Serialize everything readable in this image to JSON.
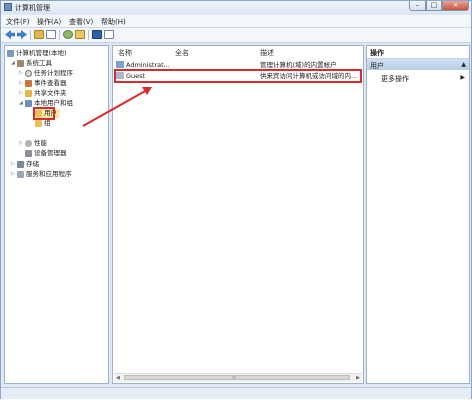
{
  "window": {
    "title": "计算机管理",
    "buttons": {
      "minimize": "–",
      "maximize": "□",
      "close": "×"
    }
  },
  "menu": [
    {
      "label": "文件(F)"
    },
    {
      "label": "操作(A)"
    },
    {
      "label": "查看(V)"
    },
    {
      "label": "帮助(H)"
    }
  ],
  "tree": [
    {
      "label": "计算机管理(本地)",
      "icon": "computer-icon",
      "level": 0
    },
    {
      "label": "系统工具",
      "icon": "tools-icon",
      "level": 1,
      "expander": "◢"
    },
    {
      "label": "任务计划程序",
      "icon": "clock-icon",
      "level": 2,
      "expander": "▷"
    },
    {
      "label": "事件查看器",
      "icon": "event-viewer-icon",
      "level": 2,
      "expander": "▷"
    },
    {
      "label": "共享文件夹",
      "icon": "shared-folder-icon",
      "level": 2,
      "expander": "▷"
    },
    {
      "label": "本地用户和组",
      "icon": "users-icon",
      "level": 2,
      "expander": "◢"
    },
    {
      "label": "用户",
      "icon": "folder-icon",
      "level": 3,
      "selected": true
    },
    {
      "label": "组",
      "icon": "folder-icon",
      "level": 3
    },
    {
      "label": "性能",
      "icon": "performance-icon",
      "level": 2,
      "expander": "▷"
    },
    {
      "label": "设备管理器",
      "icon": "device-manager-icon",
      "level": 2
    },
    {
      "label": "存储",
      "icon": "storage-icon",
      "level": 1,
      "expander": "▷"
    },
    {
      "label": "服务和应用程序",
      "icon": "services-icon",
      "level": 1,
      "expander": "▷"
    }
  ],
  "list": {
    "columns": [
      "名称",
      "全名",
      "描述"
    ],
    "rows": [
      {
        "name": "Administrat...",
        "fullname": "",
        "description": "管理计算机(域)的内置帐户"
      },
      {
        "name": "Guest",
        "fullname": "",
        "description": "供来宾访问计算机或访问域的内..."
      }
    ]
  },
  "actions": {
    "header": "操作",
    "section": "用户",
    "section_arrow": "▲",
    "more": "更多操作",
    "more_arrow": "▶"
  },
  "scrollbar": {
    "left_arrow": "◀",
    "right_arrow": "▶",
    "grip": "≡"
  },
  "colors": {
    "highlight": "#d92b2b",
    "selection": "#fde9a8",
    "window_bg": "#dfe8f3"
  }
}
